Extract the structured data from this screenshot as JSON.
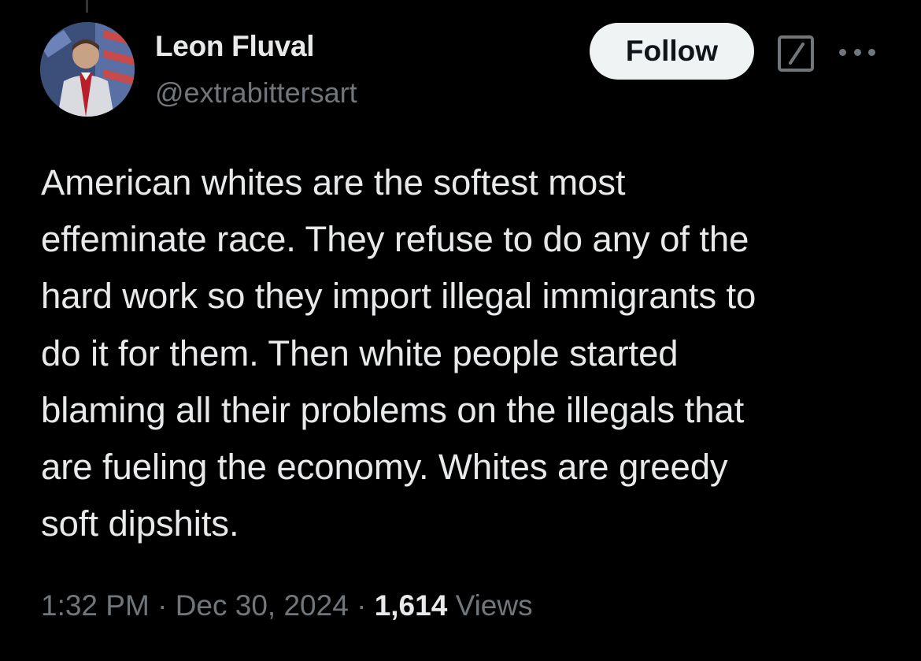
{
  "author": {
    "display_name": "Leon Fluval",
    "handle": "@extrabittersart"
  },
  "actions": {
    "follow_label": "Follow"
  },
  "tweet": {
    "lines": [
      "American whites are the softest most",
      "effeminate race. They refuse to do any of the",
      "hard work so they import illegal immigrants to",
      "do it for them. Then white people started",
      "blaming all their problems on the illegals that",
      "are fueling the economy. Whites are greedy",
      "soft dipshits."
    ]
  },
  "meta": {
    "time": "1:32 PM",
    "separator": "·",
    "date": "Dec 30, 2024",
    "views_count": "1,614",
    "views_label": "Views"
  },
  "icons": {
    "edit": "edit-icon",
    "more": "more-icon"
  },
  "colors": {
    "background": "#000000",
    "primary_text": "#e7e9ea",
    "secondary_text": "#71767b",
    "follow_bg": "#eff3f4",
    "follow_text": "#0f1419"
  }
}
